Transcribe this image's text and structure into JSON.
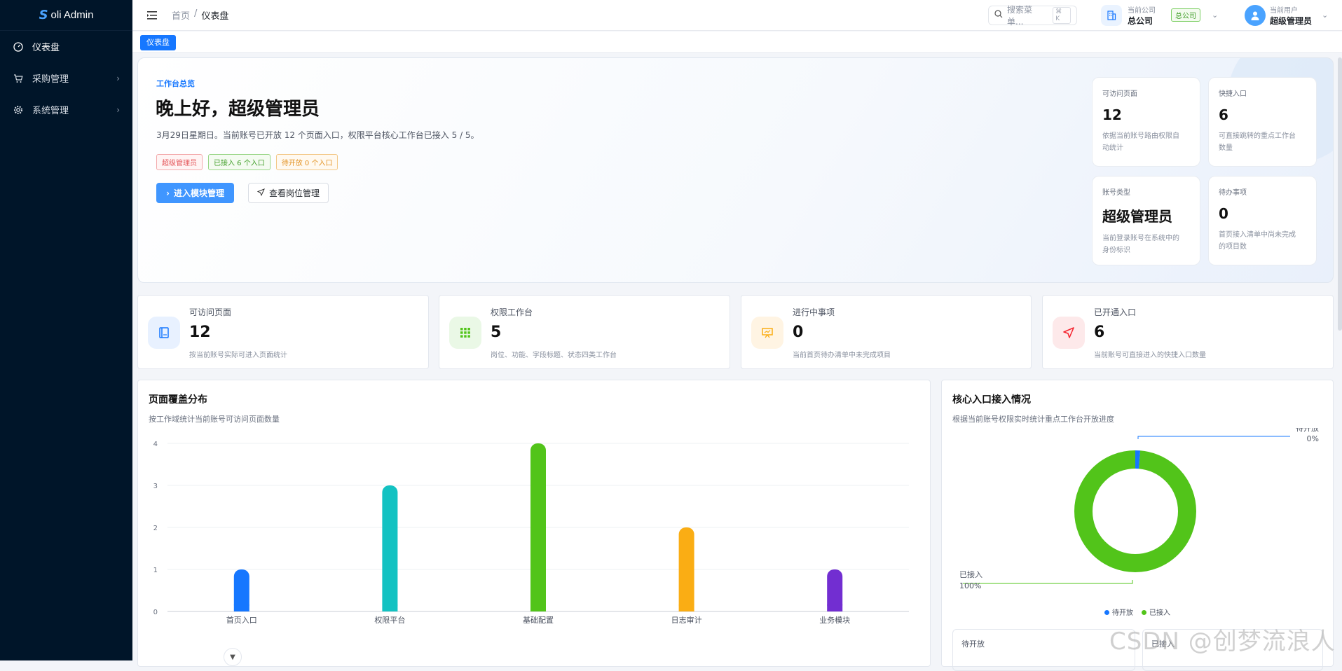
{
  "app": {
    "logo_mark": "S",
    "logo_text": "oli Admin"
  },
  "sidebar": {
    "items": [
      {
        "label": "仪表盘",
        "icon": "dashboard-icon",
        "active": true
      },
      {
        "label": "采购管理",
        "icon": "cart-icon"
      },
      {
        "label": "系统管理",
        "icon": "gear-icon"
      }
    ]
  },
  "header": {
    "breadcrumb": {
      "home": "首页",
      "sep": "/",
      "current": "仪表盘"
    },
    "search": {
      "placeholder": "搜索菜单...",
      "shortcut": "⌘ K"
    },
    "company": {
      "label": "当前公司",
      "name": "总公司",
      "tag": "总公司"
    },
    "user": {
      "label": "当前用户",
      "name": "超级管理员"
    }
  },
  "tabs": [
    {
      "label": "仪表盘"
    }
  ],
  "hero": {
    "eyebrow": "工作台总览",
    "title": "晚上好，超级管理员",
    "description": "3月29日星期日。当前账号已开放 12 个页面入口，权限平台核心工作台已接入 5 / 5。",
    "tags": [
      "超级管理员",
      "已接入 6 个入口",
      "待开放 0 个入口"
    ],
    "primary_button": "进入模块管理",
    "secondary_button": "查看岗位管理",
    "cards": [
      {
        "label": "可访问页面",
        "value": "12",
        "desc1": "依据当前账号路由权限自",
        "desc2": "动统计"
      },
      {
        "label": "快捷入口",
        "value": "6",
        "desc1": "可直接跳转的重点工作台",
        "desc2": "数量"
      },
      {
        "label": "账号类型",
        "value": "超级管理员",
        "desc1": "当前登录账号在系统中的",
        "desc2": "身份标识"
      },
      {
        "label": "待办事项",
        "value": "0",
        "desc1": "首页接入清单中尚未完成",
        "desc2": "的项目数"
      }
    ]
  },
  "stats": [
    {
      "label": "可访问页面",
      "value": "12",
      "desc": "按当前账号实际可进入页面统计"
    },
    {
      "label": "权限工作台",
      "value": "5",
      "desc": "岗位、功能、字段标题、状态四类工作台"
    },
    {
      "label": "进行中事项",
      "value": "0",
      "desc": "当前首页待办清单中未完成项目"
    },
    {
      "label": "已开通入口",
      "value": "6",
      "desc": "当前账号可直接进入的快捷入口数量"
    }
  ],
  "bar_panel": {
    "title": "页面覆盖分布",
    "subtitle": "按工作域统计当前账号可访问页面数量"
  },
  "pie_panel": {
    "title": "核心入口接入情况",
    "subtitle": "根据当前账号权限实时统计重点工作台开放进度",
    "pending_label": "待开放",
    "pending_pct": "0%",
    "done_label": "已接入",
    "done_pct": "100%",
    "legend": [
      "待开放",
      "已接入"
    ],
    "card_labels": [
      "待开放",
      "已接入"
    ]
  },
  "watermark": "CSDN @创梦流浪人",
  "chart_data": [
    {
      "type": "bar",
      "categories": [
        "首页入口",
        "权限平台",
        "基础配置",
        "日志审计",
        "业务模块"
      ],
      "values": [
        1,
        3,
        4,
        2,
        1
      ],
      "colors": [
        "#1677ff",
        "#13c2c2",
        "#52c41a",
        "#faad14",
        "#722ed1"
      ],
      "yticks": [
        "0",
        "1",
        "2",
        "3",
        "4"
      ],
      "ylim": [
        0,
        4
      ]
    },
    {
      "type": "pie",
      "labels": [
        "待开放",
        "已接入"
      ],
      "values": [
        0,
        100
      ],
      "colors": [
        "#1677ff",
        "#52c41a"
      ]
    }
  ]
}
